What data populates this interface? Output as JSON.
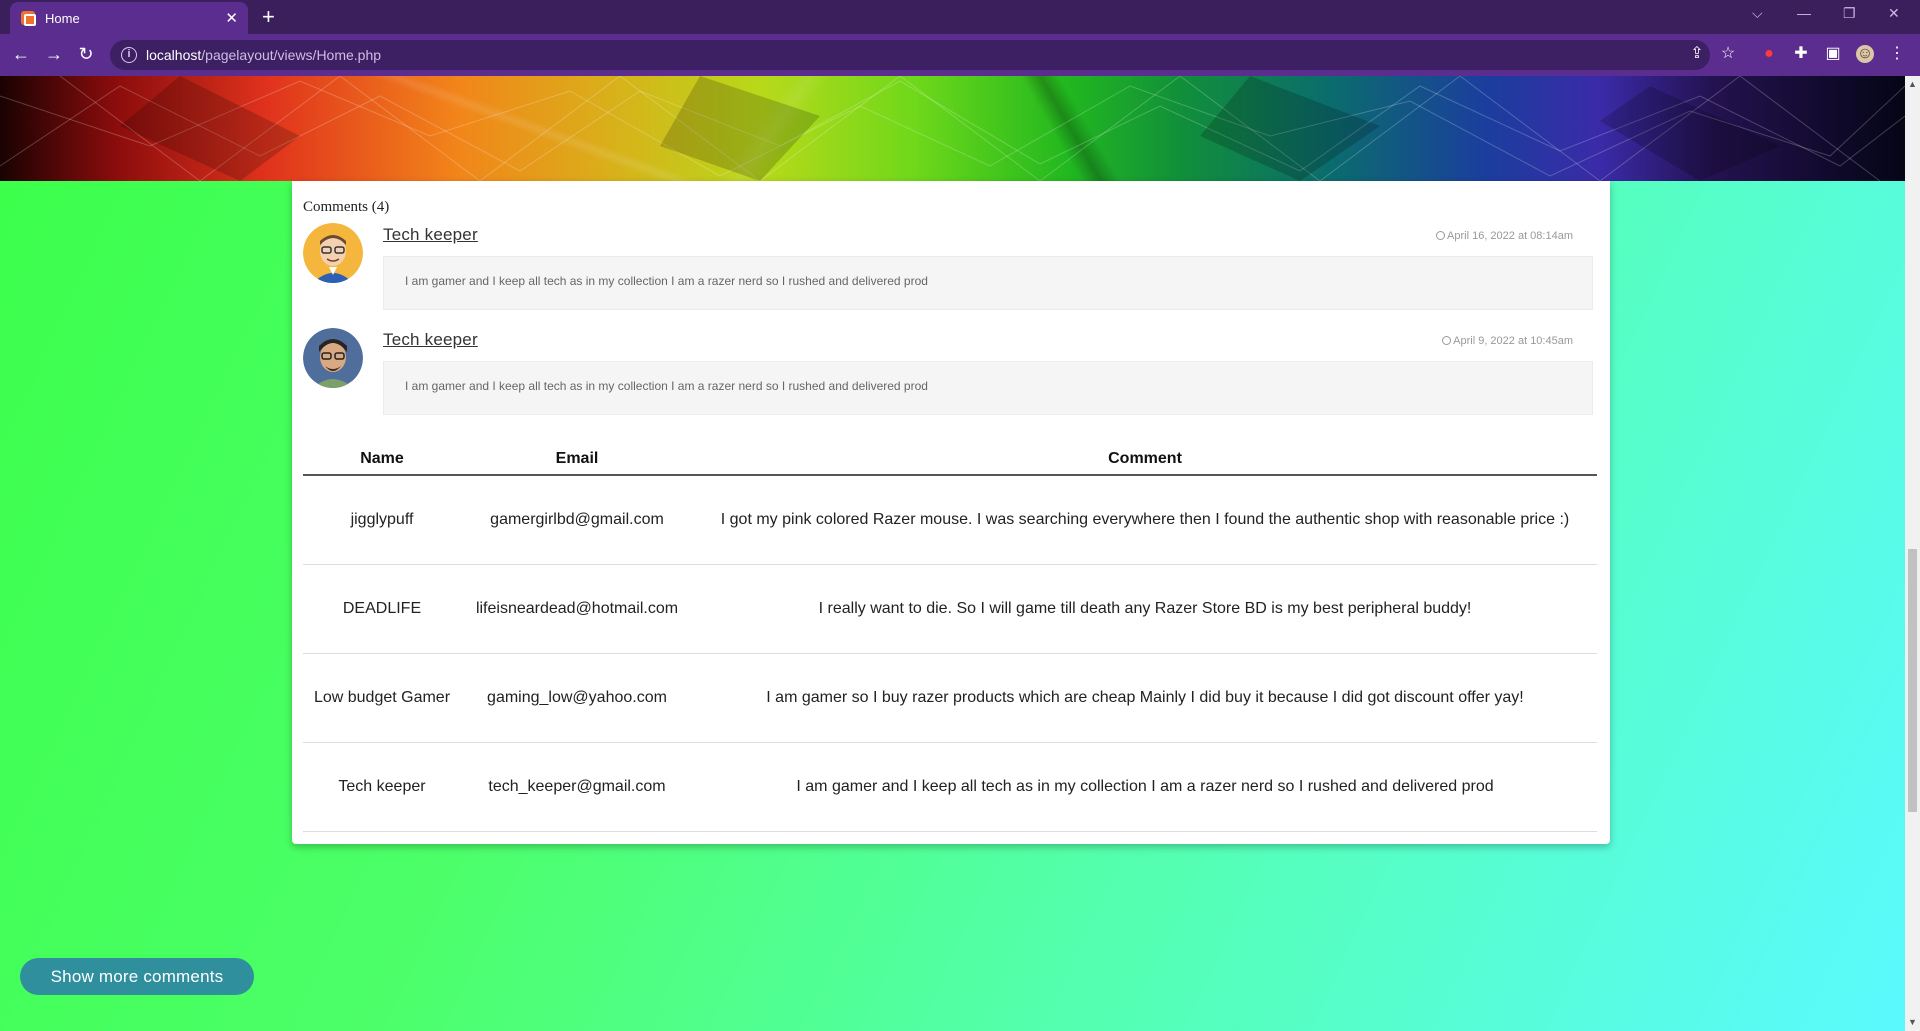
{
  "browser": {
    "tab_title": "Home",
    "new_tab": "+",
    "url_host": "localhost",
    "url_path": "/pagelayout/views/Home.php",
    "icons": [
      "back-icon",
      "forward-icon",
      "reload-icon",
      "info-icon",
      "share-icon",
      "star-icon",
      "extension-icon",
      "puzzle-icon",
      "sidepanel-icon",
      "profile-icon",
      "menu-icon"
    ]
  },
  "comments": {
    "heading": "Comments (4)",
    "items": [
      {
        "name": "Tech keeper",
        "date": "April 16, 2022 at 08:14am",
        "text": "I am gamer and I keep all tech as in my collection I am a razer nerd so I rushed and delivered prod"
      },
      {
        "name": "Tech keeper",
        "date": "April 9, 2022 at 10:45am",
        "text": "I am gamer and I keep all tech as in my collection I am a razer nerd so I rushed and delivered prod"
      }
    ]
  },
  "table": {
    "headers": [
      "Name",
      "Email",
      "Comment"
    ],
    "rows": [
      [
        "jigglypuff",
        "gamergirlbd@gmail.com",
        "I got my pink colored Razer mouse. I was searching everywhere then I found the authentic shop with reasonable price :)"
      ],
      [
        "DEADLIFE",
        "lifeisneardead@hotmail.com",
        "I really want to die. So I will game till death any Razer Store BD is my best peripheral buddy!"
      ],
      [
        "Low budget Gamer",
        "gaming_low@yahoo.com",
        "I am gamer so I buy razer products which are cheap Mainly I did buy it because I did got discount offer yay!"
      ],
      [
        "Tech keeper",
        "tech_keeper@gmail.com",
        "I am gamer and I keep all tech as in my collection I am a razer nerd so I rushed and delivered prod"
      ]
    ]
  },
  "show_more_label": "Show more comments",
  "colors": {
    "chrome": "#5b2d8f",
    "button": "#2f8f9d"
  }
}
